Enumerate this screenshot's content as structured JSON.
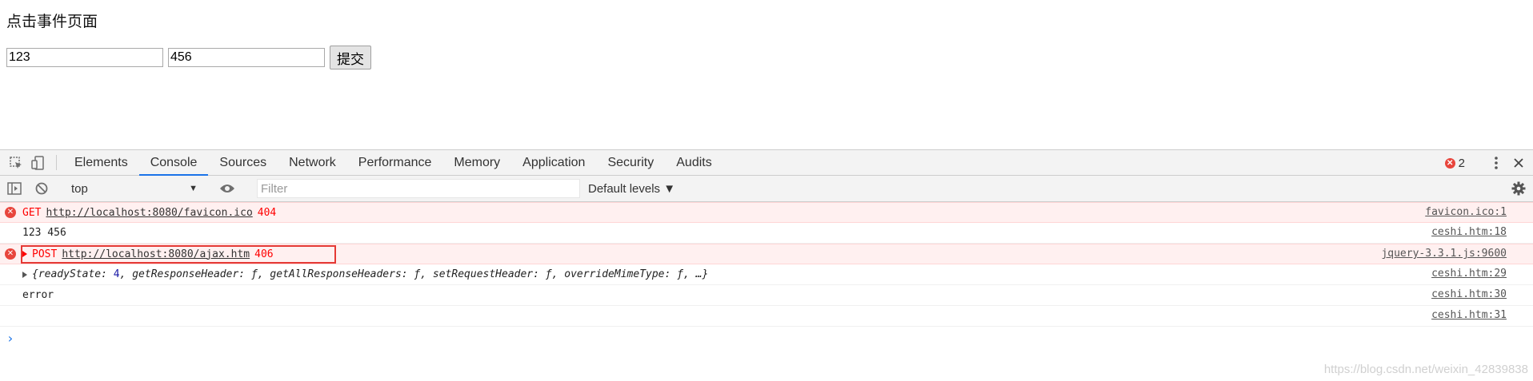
{
  "page": {
    "title": "点击事件页面",
    "input1_value": "123",
    "input2_value": "456",
    "submit_label": "提交"
  },
  "devtools": {
    "tabs": [
      "Elements",
      "Console",
      "Sources",
      "Network",
      "Performance",
      "Memory",
      "Application",
      "Security",
      "Audits"
    ],
    "active_tab": "Console",
    "error_count": "2",
    "context": "top",
    "filter_placeholder": "Filter",
    "levels_label": "Default levels ▼",
    "accent_color": "#1a73e8",
    "error_color": "#ff0000",
    "icons": {
      "inspect": "inspect-element-icon",
      "device": "device-toolbar-icon",
      "more": "more-vertical-icon",
      "close": "close-icon",
      "sidebar": "console-sidebar-icon",
      "clear": "clear-console-icon",
      "eye": "live-expression-eye-icon",
      "settings": "gear-icon"
    }
  },
  "console": {
    "messages": [
      {
        "type": "error",
        "method": "GET",
        "url": "http://localhost:8080/favicon.ico",
        "status": "404",
        "source": "favicon.ico:1"
      },
      {
        "type": "log",
        "text": "123 456",
        "source": "ceshi.htm:18"
      },
      {
        "type": "error",
        "method": "POST",
        "url": "http://localhost:8080/ajax.htm",
        "status": "406",
        "source": "jquery-3.3.1.js:9600"
      },
      {
        "type": "object",
        "prefix": "{readyState: ",
        "num": "4",
        "rest": ", getResponseHeader: ƒ, getAllResponseHeaders: ƒ, setRequestHeader: ƒ, overrideMimeType: ƒ, …}",
        "source": "ceshi.htm:29"
      },
      {
        "type": "log",
        "text": "error",
        "source": "ceshi.htm:30"
      },
      {
        "type": "log",
        "text": "",
        "source": "ceshi.htm:31"
      }
    ],
    "prompt": "›"
  },
  "watermark": "https://blog.csdn.net/weixin_42839838"
}
